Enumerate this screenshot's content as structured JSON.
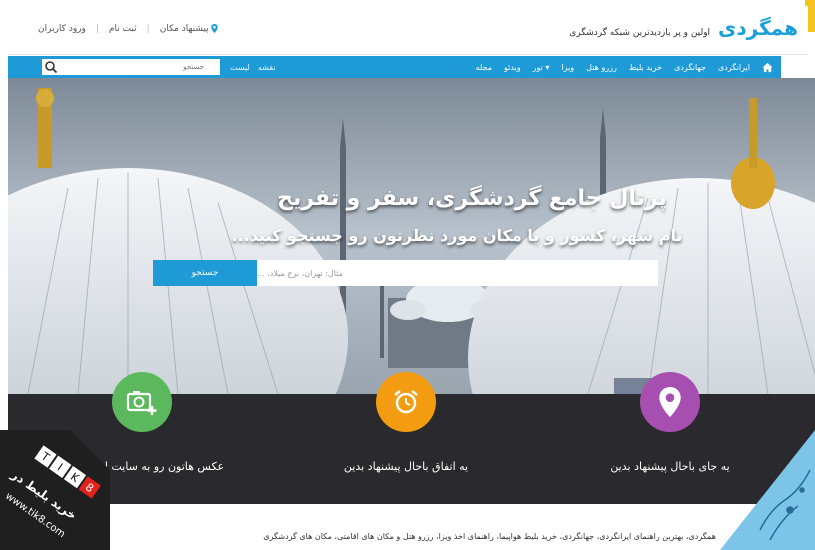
{
  "header": {
    "logo": "همگردی",
    "tagline": "اولین و پر بازدیدترین شبکه گردشگری",
    "suggest_place": "پیشنهاد مکان",
    "register": "ثبت نام",
    "login": "ورود کاربران"
  },
  "nav": {
    "items": [
      "ایرانگردی",
      "جهانگردی",
      "خرید بلیط",
      "رزرو هتل",
      "ویزا",
      "تور ▾",
      "ویدئو",
      "مجله"
    ],
    "list_link": "لیست",
    "map_link": "نقشه",
    "search_placeholder": "جستجو"
  },
  "hero": {
    "title": "پرتال جامع گردشگری، سفر و تفریح",
    "subtitle": "نام شهر، کشور و یا مکان مورد نظرتون رو جستجو کنید...",
    "search_placeholder": "مثال: تهران، برج میلاد، ...",
    "search_button": "جستجو"
  },
  "features": [
    {
      "label": "یه جای باحال پیشنهاد بدین",
      "icon": "map-pin-icon",
      "color": "#a64fb1"
    },
    {
      "label": "یه اتفاق باحال پیشنهاد بدین",
      "icon": "alarm-clock-icon",
      "color": "#f39c12"
    },
    {
      "label": "عکس هاتون رو به سایت اضافه کنید",
      "icon": "add-photo-icon",
      "color": "#5cb85c"
    }
  ],
  "footer": {
    "text": "همگردی، بهترین راهنمای ایرانگردی، جهانگردی، خرید بلیط هواپیما، راهنمای اخذ ویزا، رزرو هتل و مکان های اقامتی، مکان های گردشگری"
  },
  "watermark": {
    "brand": "TIK8",
    "text": "خرید بلیط در",
    "url": "www.tik8.com"
  },
  "colors": {
    "accent": "#1e9ad6",
    "dark_band": "#2a2a2e"
  }
}
